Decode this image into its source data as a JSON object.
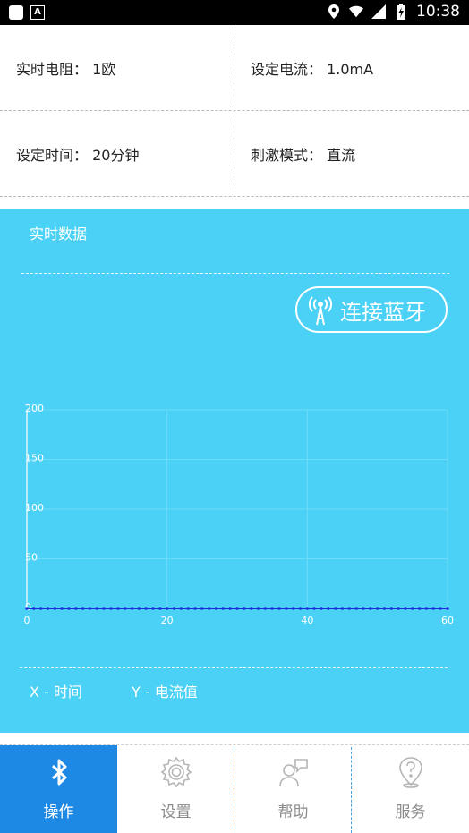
{
  "status_bar": {
    "time": "10:38"
  },
  "info": {
    "realtime_resistance": "实时电阻：  1欧",
    "set_current": "设定电流：  1.0mA",
    "set_time": "设定时间：  20分钟",
    "stim_mode": "刺激模式：  直流"
  },
  "panel": {
    "title": "实时数据",
    "connect_button": "连接蓝牙",
    "legend_x": "X - 时间",
    "legend_y": "Y - 电流值"
  },
  "chart_data": {
    "type": "line",
    "x_ticks": [
      "0",
      "20",
      "40",
      "60"
    ],
    "y_ticks": [
      "0",
      "50",
      "100",
      "150",
      "200"
    ],
    "xlim": [
      0,
      60
    ],
    "ylim": [
      0,
      200
    ],
    "series": [
      {
        "color": "#1a2bdc",
        "x": [
          0,
          60
        ],
        "y": [
          0,
          0
        ]
      }
    ],
    "grid": true
  },
  "nav": {
    "items": [
      {
        "label": "操作",
        "icon": "bluetooth-icon",
        "active": true
      },
      {
        "label": "设置",
        "icon": "gear-icon",
        "active": false
      },
      {
        "label": "帮助",
        "icon": "support-chat-icon",
        "active": false
      },
      {
        "label": "服务",
        "icon": "service-pin-icon",
        "active": false
      }
    ]
  },
  "colors": {
    "panel": "#4cd1f6",
    "active_tab": "#1e88e5",
    "series": "#1a2bdc"
  }
}
